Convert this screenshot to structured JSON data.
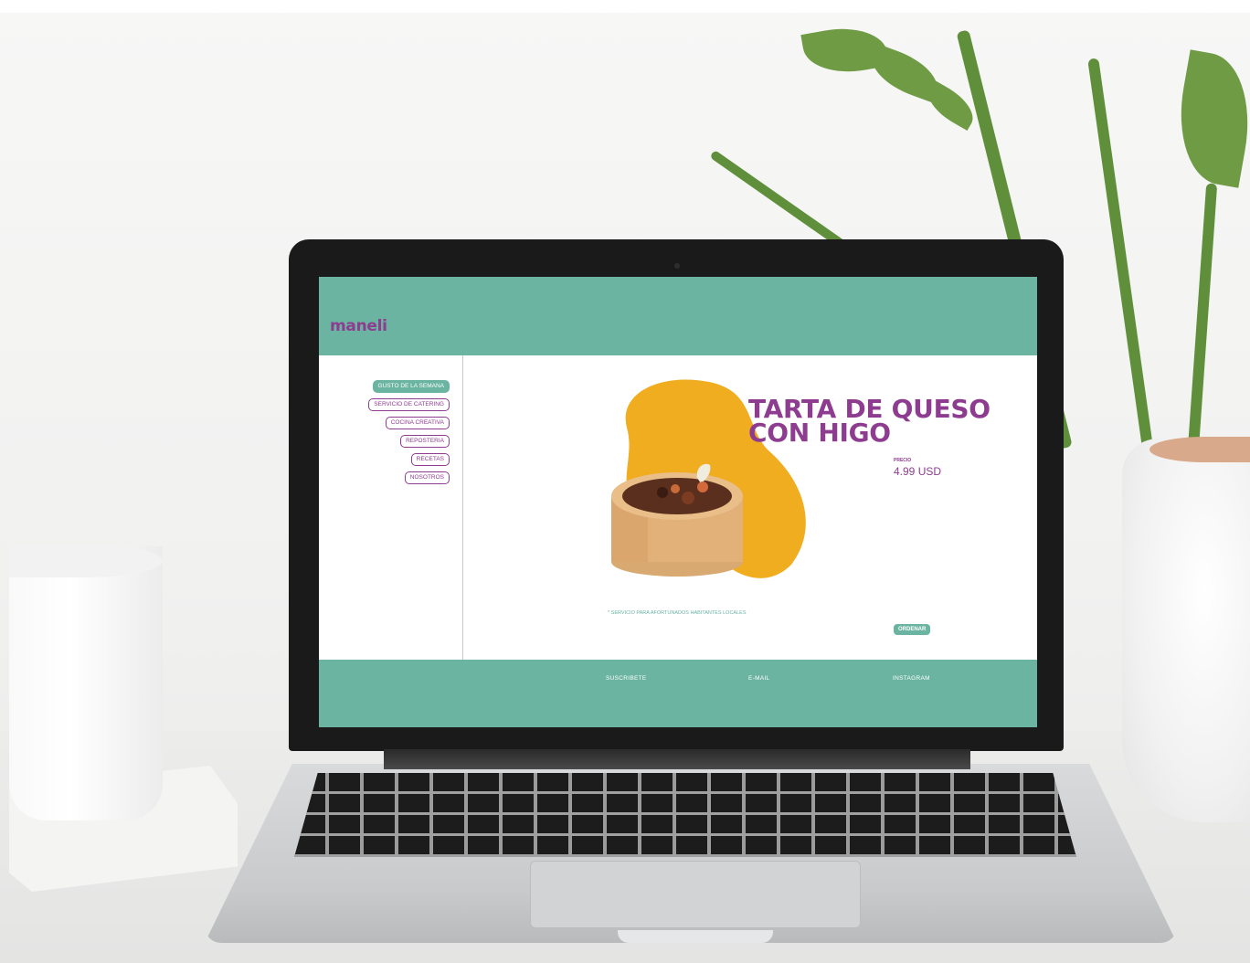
{
  "site": {
    "logo": "maneli",
    "nav": [
      {
        "label": "GUSTO DE LA SEMANA",
        "active": true
      },
      {
        "label": "SERVICIO DE CATERING",
        "active": false
      },
      {
        "label": "COCINA CREATIVA",
        "active": false
      },
      {
        "label": "REPOSTERIA",
        "active": false
      },
      {
        "label": "RECETAS",
        "active": false
      },
      {
        "label": "NOSOTROS",
        "active": false
      }
    ],
    "product": {
      "title_line1": "TARTA DE QUESO",
      "title_line2": "CON HIGO",
      "price_label": "PRECIO",
      "price_value": "4.99 USD",
      "footnote": "* SERVICIO PARA AFORTUNADOS HABITANTES LOCALES",
      "order_button": "ORDENAR"
    },
    "footer": {
      "links": [
        "SUSCRIBETE",
        "E-MAIL",
        "INSTAGRAM"
      ]
    },
    "colors": {
      "teal": "#6ab4a1",
      "purple": "#8e3c90",
      "mustard": "#efad1f"
    }
  }
}
